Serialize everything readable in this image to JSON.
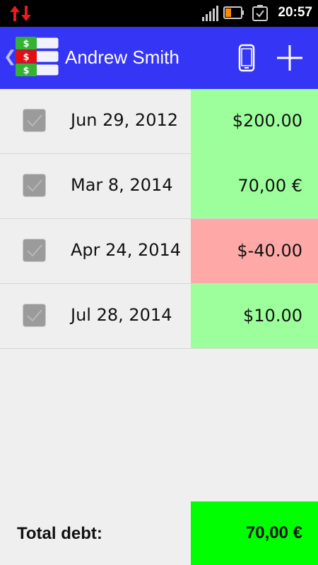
{
  "status_bar": {
    "time": "20:57",
    "icons": [
      "data-transfer-icon",
      "signal-icon",
      "battery-icon",
      "alarm-icon"
    ]
  },
  "action_bar": {
    "title": "Andrew Smith",
    "back_icon": "chevron-left-icon",
    "app_icon": "money-stack-icon",
    "actions": [
      "phone-icon",
      "add-icon"
    ]
  },
  "debts": [
    {
      "date": "Jun 29, 2012",
      "amount": "$200.00",
      "checked": true,
      "status_color": "#9cff9c"
    },
    {
      "date": "Mar 8, 2014",
      "amount": "70,00 €",
      "checked": true,
      "status_color": "#9cff9c"
    },
    {
      "date": "Apr 24, 2014",
      "amount": "$-40.00",
      "checked": true,
      "status_color": "#ffa8a8"
    },
    {
      "date": "Jul 28, 2014",
      "amount": "$10.00",
      "checked": true,
      "status_color": "#9cff9c"
    }
  ],
  "footer": {
    "label": "Total debt:",
    "total": "70,00 €",
    "total_color": "#00ff00"
  },
  "colors": {
    "action_bar": "#3535f5",
    "background": "#efefef"
  }
}
